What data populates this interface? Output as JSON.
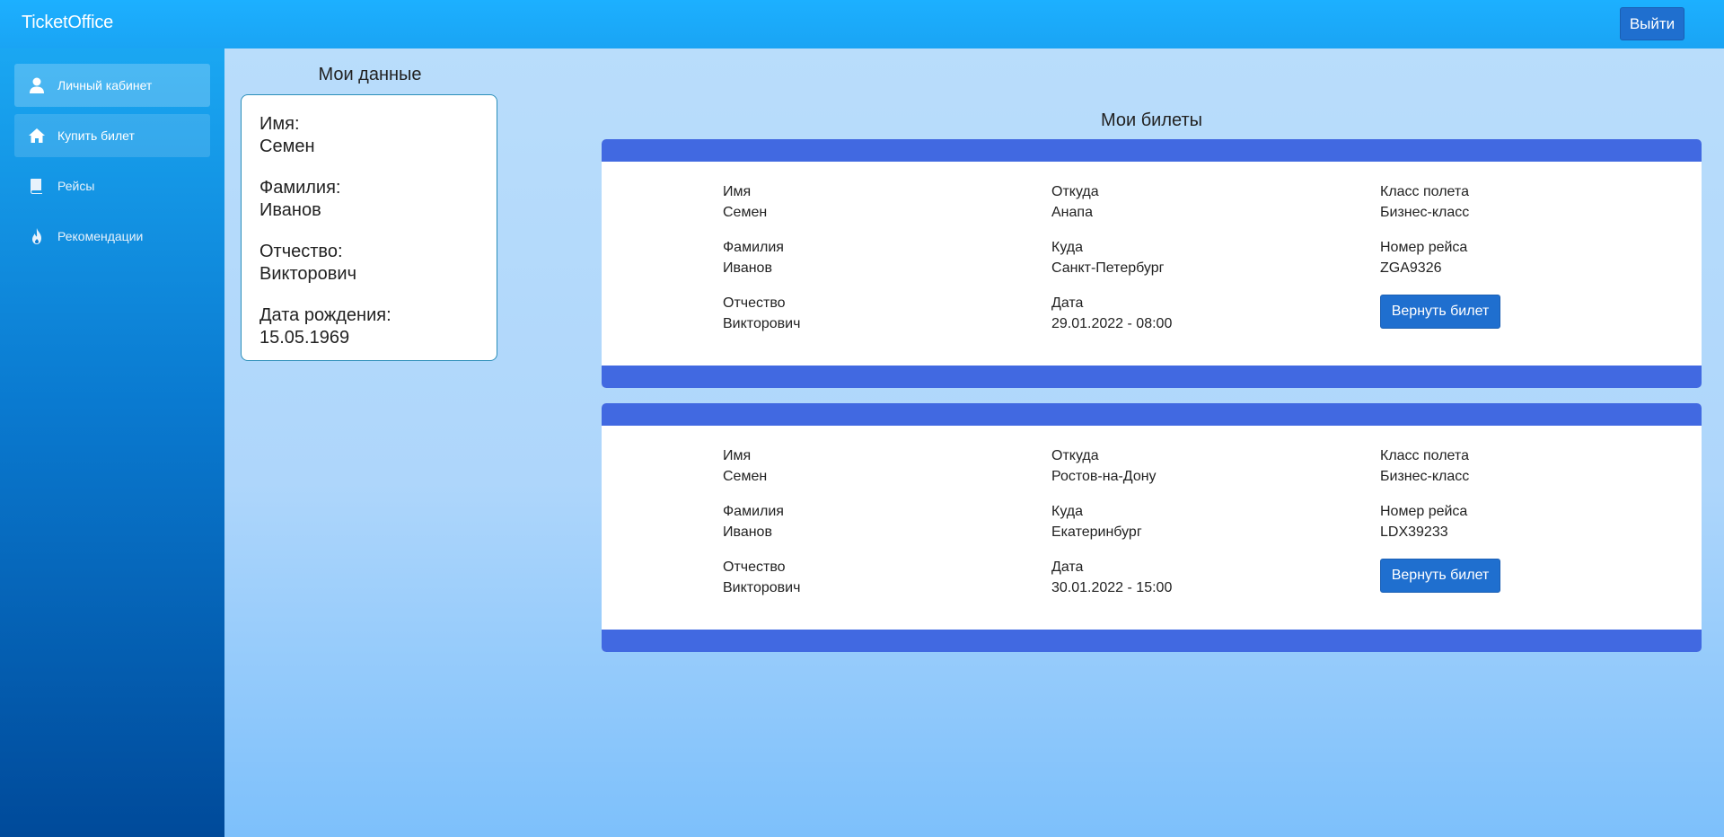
{
  "header": {
    "brand": "TicketOffice",
    "logout_label": "Выйти"
  },
  "sidebar": {
    "items": [
      {
        "label": "Личный кабинет",
        "icon": "user-icon",
        "state": "active"
      },
      {
        "label": "Купить билет",
        "icon": "home-icon",
        "state": "hover"
      },
      {
        "label": "Рейсы",
        "icon": "book-icon",
        "state": "normal"
      },
      {
        "label": "Рекомендации",
        "icon": "fire-icon",
        "state": "normal"
      }
    ]
  },
  "profile": {
    "title": "Мои данные",
    "fields": [
      {
        "label": "Имя:",
        "value": "Семен"
      },
      {
        "label": "Фамилия:",
        "value": "Иванов"
      },
      {
        "label": "Отчество:",
        "value": "Викторович"
      },
      {
        "label": "Дата рождения:",
        "value": "15.05.1969"
      }
    ]
  },
  "tickets": {
    "title": "Мои билеты",
    "return_label": "Вернуть билет",
    "items": [
      {
        "first_name_label": "Имя",
        "first_name": "Семен",
        "last_name_label": "Фамилия",
        "last_name": "Иванов",
        "patronymic_label": "Отчество",
        "patronymic": "Викторович",
        "from_label": "Откуда",
        "from": "Анапа",
        "to_label": "Куда",
        "to": "Санкт-Петербург",
        "date_label": "Дата",
        "date": "29.01.2022 - 08:00",
        "class_label": "Класс полета",
        "class": "Бизнес-класс",
        "flight_label": "Номер рейса",
        "flight": "ZGA9326"
      },
      {
        "first_name_label": "Имя",
        "first_name": "Семен",
        "last_name_label": "Фамилия",
        "last_name": "Иванов",
        "patronymic_label": "Отчество",
        "patronymic": "Викторович",
        "from_label": "Откуда",
        "from": "Ростов-на-Дону",
        "to_label": "Куда",
        "to": "Екатеринбург",
        "date_label": "Дата",
        "date": "30.01.2022 - 15:00",
        "class_label": "Класс полета",
        "class": "Бизнес-класс",
        "flight_label": "Номер рейса",
        "flight": "LDX39233"
      }
    ]
  },
  "colors": {
    "topbar": "#1cb0ff",
    "ticket_band": "#4169e1",
    "button": "#1f6fcf"
  }
}
